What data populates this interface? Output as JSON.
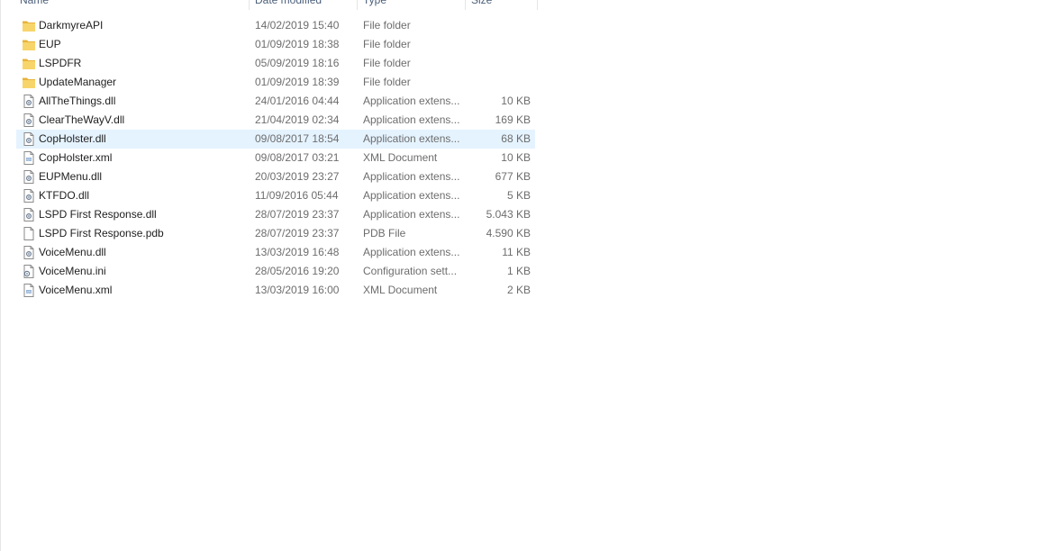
{
  "header": {
    "name": "Name",
    "date": "Date modified",
    "type": "Type",
    "size": "Size"
  },
  "files": [
    {
      "icon": "folder-icon",
      "name": "DarkmyreAPI",
      "date": "14/02/2019 15:40",
      "type": "File folder",
      "size": ""
    },
    {
      "icon": "folder-icon",
      "name": "EUP",
      "date": "01/09/2019 18:38",
      "type": "File folder",
      "size": ""
    },
    {
      "icon": "folder-icon",
      "name": "LSPDFR",
      "date": "05/09/2019 18:16",
      "type": "File folder",
      "size": ""
    },
    {
      "icon": "folder-icon",
      "name": "UpdateManager",
      "date": "01/09/2019 18:39",
      "type": "File folder",
      "size": ""
    },
    {
      "icon": "dll-file-icon",
      "name": "AllTheThings.dll",
      "date": "24/01/2016 04:44",
      "type": "Application extens...",
      "size": "10 KB"
    },
    {
      "icon": "dll-file-icon",
      "name": "ClearTheWayV.dll",
      "date": "21/04/2019 02:34",
      "type": "Application extens...",
      "size": "169 KB"
    },
    {
      "icon": "dll-file-icon",
      "name": "CopHolster.dll",
      "date": "09/08/2017 18:54",
      "type": "Application extens...",
      "size": "68 KB",
      "selected": true
    },
    {
      "icon": "xml-file-icon",
      "name": "CopHolster.xml",
      "date": "09/08/2017 03:21",
      "type": "XML Document",
      "size": "10 KB"
    },
    {
      "icon": "dll-file-icon",
      "name": "EUPMenu.dll",
      "date": "20/03/2019 23:27",
      "type": "Application extens...",
      "size": "677 KB"
    },
    {
      "icon": "dll-file-icon",
      "name": "KTFDO.dll",
      "date": "11/09/2016 05:44",
      "type": "Application extens...",
      "size": "5 KB"
    },
    {
      "icon": "dll-file-icon",
      "name": "LSPD First Response.dll",
      "date": "28/07/2019 23:37",
      "type": "Application extens...",
      "size": "5.043 KB"
    },
    {
      "icon": "blank-file-icon",
      "name": "LSPD First Response.pdb",
      "date": "28/07/2019 23:37",
      "type": "PDB File",
      "size": "4.590 KB"
    },
    {
      "icon": "dll-file-icon",
      "name": "VoiceMenu.dll",
      "date": "13/03/2019 16:48",
      "type": "Application extens...",
      "size": "11 KB"
    },
    {
      "icon": "ini-file-icon",
      "name": "VoiceMenu.ini",
      "date": "28/05/2016 19:20",
      "type": "Configuration sett...",
      "size": "1 KB"
    },
    {
      "icon": "xml-file-icon",
      "name": "VoiceMenu.xml",
      "date": "13/03/2019 16:00",
      "type": "XML Document",
      "size": "2 KB"
    }
  ],
  "colors": {
    "selection": "#e5f3ff",
    "folder": "#f4c54a",
    "header_text": "#4c607a"
  }
}
